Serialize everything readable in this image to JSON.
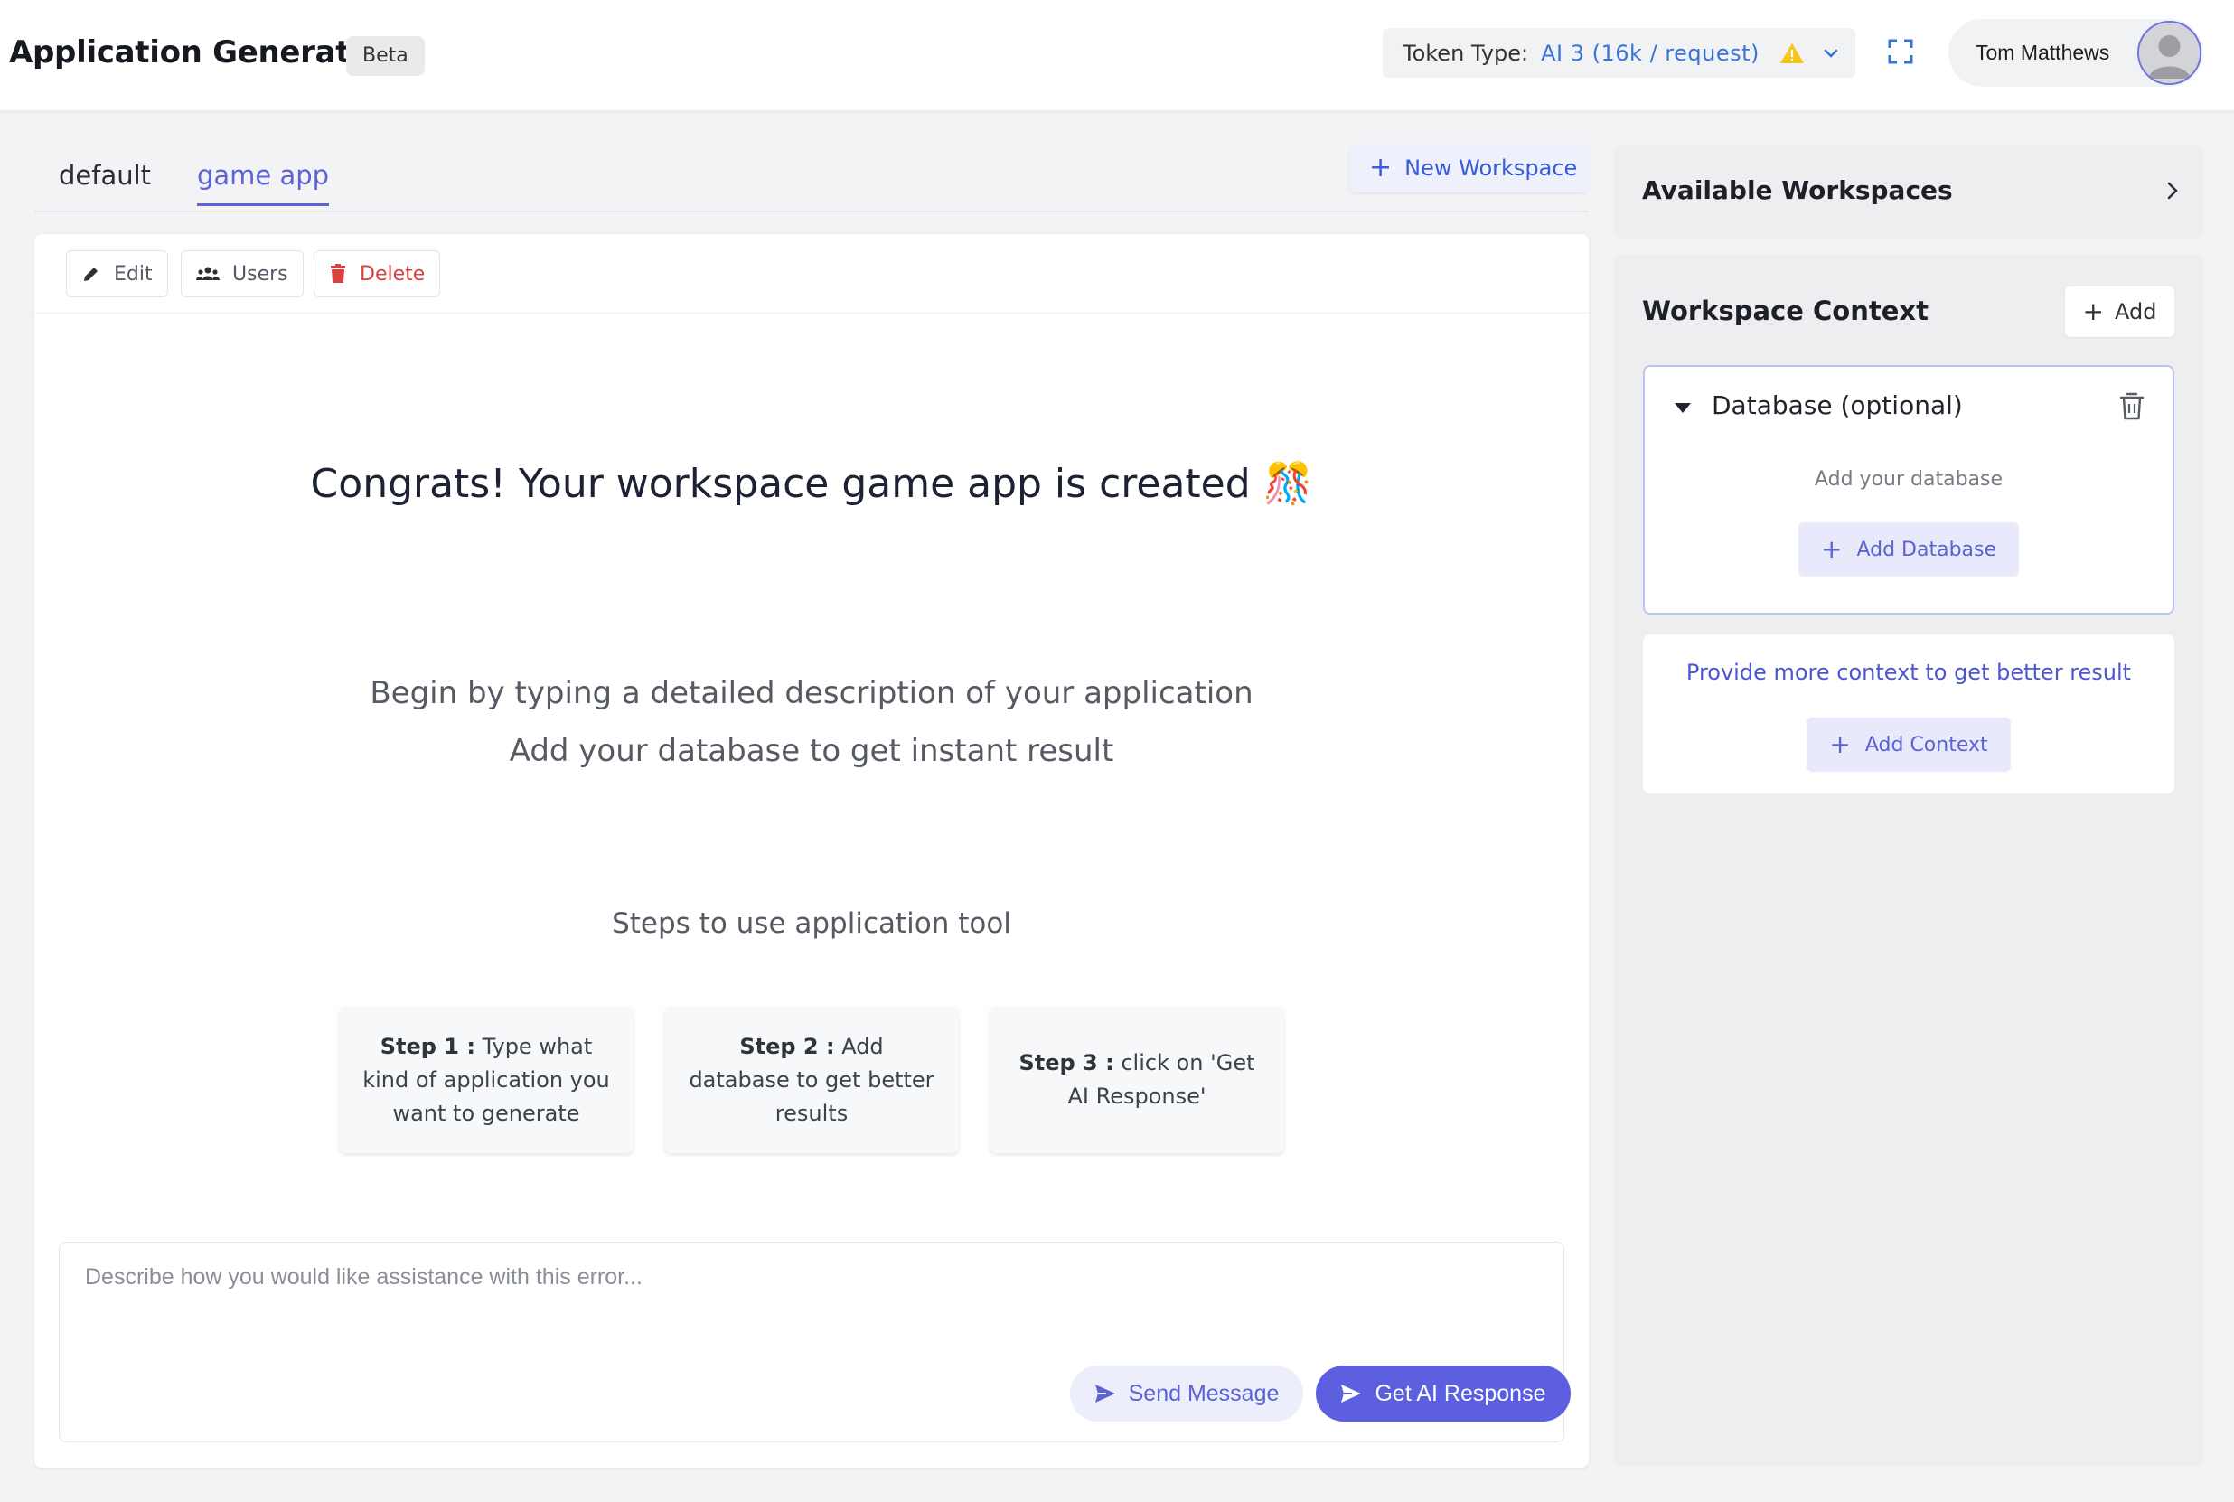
{
  "header": {
    "title": "Application Generator",
    "badge": "Beta",
    "token_label": "Token Type:",
    "token_value": "AI 3 (16k / request)",
    "user_name": "Tom Matthews"
  },
  "tabs": [
    {
      "label": "default",
      "active": false
    },
    {
      "label": "game app",
      "active": true
    }
  ],
  "new_workspace_label": "New Workspace",
  "toolbar": {
    "edit_label": "Edit",
    "users_label": "Users",
    "delete_label": "Delete"
  },
  "main": {
    "congrats": "Congrats! Your workspace game app is created 🎊",
    "intro_line1": "Begin by typing a detailed description of your application",
    "intro_line2": "Add your database to get instant result",
    "steps_title": "Steps to use application tool",
    "steps": [
      {
        "label": "Step 1 :",
        "text": " Type what kind of application you want to generate"
      },
      {
        "label": "Step 2 :",
        "text": " Add database to get better results"
      },
      {
        "label": "Step 3 :",
        "text": " click on 'Get AI Response'"
      }
    ]
  },
  "composer": {
    "placeholder": "Describe how you would like assistance with this error...",
    "value": "",
    "send_label": "Send Message",
    "ai_label": "Get AI Response"
  },
  "sidebar": {
    "available_title": "Available Workspaces",
    "context_title": "Workspace Context",
    "add_label": "Add",
    "database": {
      "title": "Database (optional)",
      "hint": "Add your database",
      "add_label": "Add Database"
    },
    "more_context_text": "Provide more context to get better result",
    "add_context_label": "Add Context"
  },
  "colors": {
    "accent": "#5b5fe0",
    "token_blue": "#3a73d8",
    "warning": "#f5c518",
    "danger": "#d94040"
  },
  "icons": [
    "warning-icon",
    "chevron-down-icon",
    "fullscreen-icon",
    "avatar",
    "plus-icon",
    "pencil-icon",
    "users-icon",
    "trash-icon",
    "send-icon",
    "chevron-right-icon",
    "caret-down-icon"
  ]
}
